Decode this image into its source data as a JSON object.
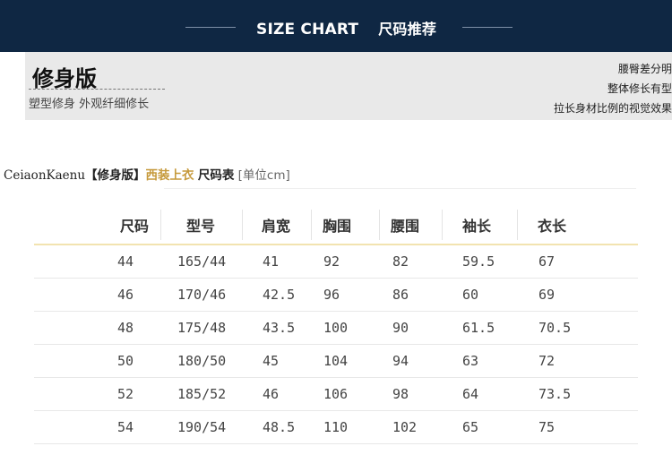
{
  "header": {
    "title_en": "SIZE CHART",
    "title_cn": "尺码推荐"
  },
  "fit": {
    "name": "修身版",
    "subtitle": "塑型修身 外观纤细修长",
    "notes": [
      "腰臀差分明",
      "整体修长有型",
      "拉长身材比例的视觉效果"
    ]
  },
  "caption": {
    "brand": "CeiaonKaenu",
    "fit": "【修身版】",
    "item": "西装上衣",
    "table": "尺码表",
    "unit": "[单位cm]"
  },
  "table": {
    "headers": [
      "尺码",
      "型号",
      "肩宽",
      "胸围",
      "腰围",
      "袖长",
      "衣长"
    ],
    "rows": [
      [
        "44",
        "165/44",
        "41",
        "92",
        "82",
        "59.5",
        "67"
      ],
      [
        "46",
        "170/46",
        "42.5",
        "96",
        "86",
        "60",
        "69"
      ],
      [
        "48",
        "175/48",
        "43.5",
        "100",
        "90",
        "61.5",
        "70.5"
      ],
      [
        "50",
        "180/50",
        "45",
        "104",
        "94",
        "63",
        "72"
      ],
      [
        "52",
        "185/52",
        "46",
        "106",
        "98",
        "64",
        "73.5"
      ],
      [
        "54",
        "190/54",
        "48.5",
        "110",
        "102",
        "65",
        "75"
      ]
    ]
  }
}
